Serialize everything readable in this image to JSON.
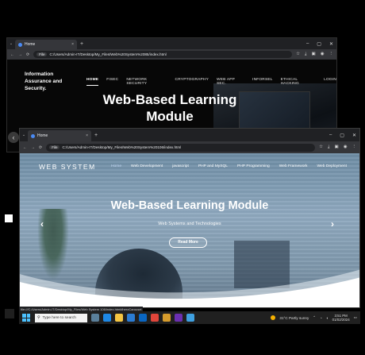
{
  "back_window": {
    "tab_title": "Home",
    "tab_close": "×",
    "new_tab": "+",
    "window_controls": [
      "–",
      "▢",
      "✕"
    ],
    "nav_icons": [
      "←",
      "→",
      "⟳"
    ],
    "url_chip": "File",
    "url": "C:/Users/Admin-IT/Desktop/My_Files/Web%20System%2085/index.html",
    "brand": "Information Assurance and Security.",
    "nav": [
      "HOME",
      "FISEC",
      "NETWORK SECURITY",
      "CRYPTOGRAPHY",
      "WEB APP SEC.",
      "INFORSEL",
      "ETHICAL HACKING",
      "LOGIN"
    ],
    "hero_title": "Web-Based Learning Module"
  },
  "front_window": {
    "tab_title": "Home",
    "tab_close": "×",
    "new_tab": "+",
    "window_controls": [
      "–",
      "▢",
      "✕"
    ],
    "nav_icons": [
      "←",
      "→",
      "⟳"
    ],
    "url_chip": "File",
    "url": "C:/Users/Admin-IT/Desktop/My_Files/Web%20System%20106/index.html",
    "brand": "WEB SYSTEM",
    "nav": [
      "Home",
      "Web Development",
      "javascript",
      "PHP and MySQL",
      "PHP Programming",
      "Web Framework",
      "Web Deployment"
    ],
    "hero_title": "Web-Based Learning Module",
    "hero_subtitle": "Web Systems and Technologies",
    "read_more": "Read More",
    "prev_arrow": "‹",
    "next_arrow": "›"
  },
  "status_url": "file:///C:/Users/Admin-IT/Desktop/My_Files/Web System 106/index.html#heroCarousel",
  "taskbar": {
    "search_placeholder": "Type here to search",
    "weather": "31°C  Partly sunny",
    "time": "3:51 PM",
    "date": "01/02/2024"
  },
  "colors": {
    "accent": "#4a8af4",
    "front_hero_sky": "#8fa9bf",
    "taskbar": "#202020"
  }
}
